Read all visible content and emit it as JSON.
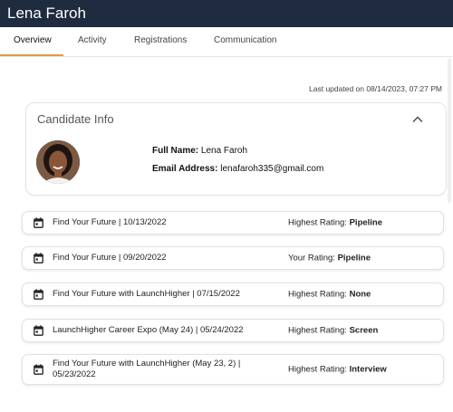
{
  "header": {
    "candidate_name": "Lena Faroh"
  },
  "tabs": [
    {
      "label": "Overview",
      "active": true
    },
    {
      "label": "Activity"
    },
    {
      "label": "Registrations"
    },
    {
      "label": "Communication"
    }
  ],
  "last_updated": "Last updated on 08/14/2023, 07:27 PM",
  "candidate_info": {
    "title": "Candidate Info",
    "full_name_label": "Full Name:",
    "full_name": "Lena Faroh",
    "email_label": "Email Address:",
    "email": "lenafaroh335@gmail.com"
  },
  "events": [
    {
      "title": "Find Your Future | 10/13/2022",
      "rating_label": "Highest Rating:",
      "rating": "Pipeline"
    },
    {
      "title": "Find Your Future | 09/20/2022",
      "rating_label": "Your Rating:",
      "rating": "Pipeline"
    },
    {
      "title": "Find Your Future with LaunchHigher | 07/15/2022",
      "rating_label": "Highest Rating:",
      "rating": "None"
    },
    {
      "title": "LaunchHigher Career Expo (May 24) | 05/24/2022",
      "rating_label": "Highest Rating:",
      "rating": "Screen"
    },
    {
      "title": "Find Your Future with LaunchHigher (May 23, 2) | 05/23/2022",
      "rating_label": "Highest Rating:",
      "rating": "Interview"
    }
  ],
  "colors": {
    "topbar": "#1f2b3e",
    "tab_accent": "#e79a3b"
  },
  "icons": {
    "event": "calendar-icon",
    "collapse": "chevron-up-icon"
  }
}
